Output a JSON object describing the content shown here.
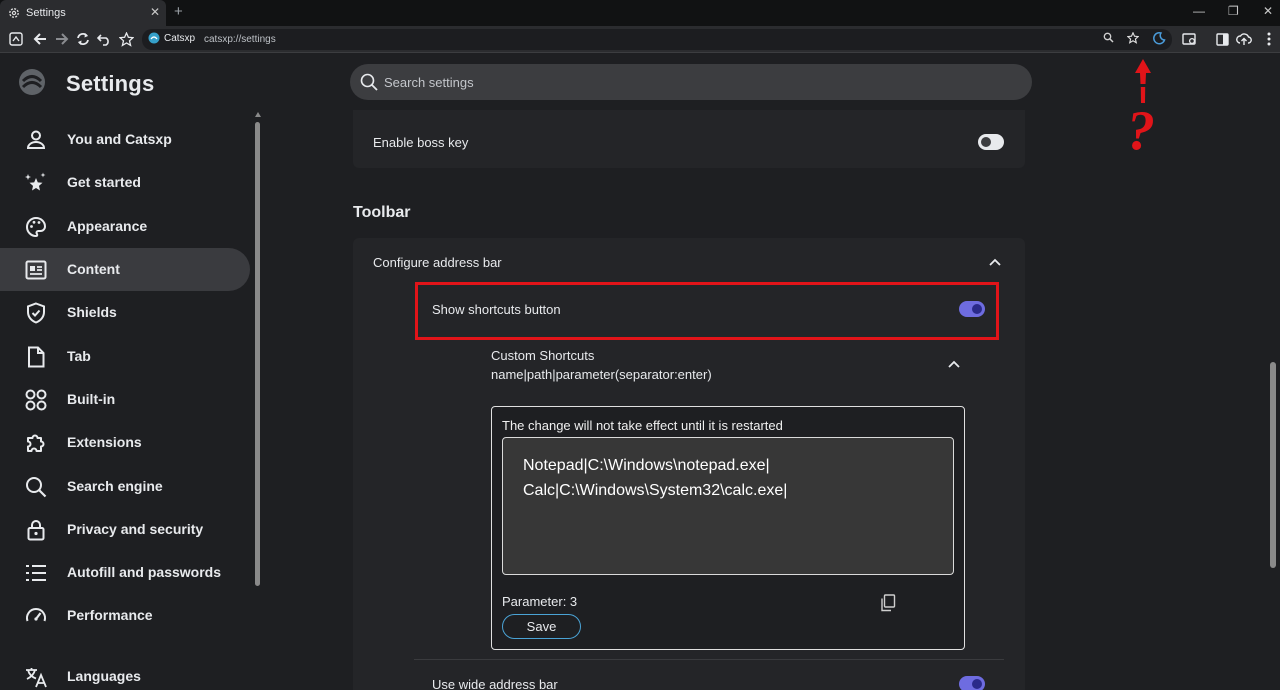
{
  "browser": {
    "tab_title": "Settings",
    "tab_close_glyph": "✕",
    "new_tab_glyph": "+",
    "window_controls": {
      "minimize": "—",
      "restore": "❐",
      "close": "✕"
    },
    "site_name": "Catsxp",
    "url": "catsxp://settings"
  },
  "header": {
    "title": "Settings",
    "search_placeholder": "Search settings"
  },
  "sidebar": {
    "items": [
      {
        "label": "You and Catsxp",
        "icon": "person-icon",
        "active": false
      },
      {
        "label": "Get started",
        "icon": "sparkle-star-icon",
        "active": false
      },
      {
        "label": "Appearance",
        "icon": "palette-icon",
        "active": false
      },
      {
        "label": "Content",
        "icon": "content-layout-icon",
        "active": true
      },
      {
        "label": "Shields",
        "icon": "shield-icon",
        "active": false
      },
      {
        "label": "Tab",
        "icon": "tab-page-icon",
        "active": false
      },
      {
        "label": "Built-in",
        "icon": "grid-circles-icon",
        "active": false
      },
      {
        "label": "Extensions",
        "icon": "puzzle-icon",
        "active": false
      },
      {
        "label": "Search engine",
        "icon": "search-icon",
        "active": false
      },
      {
        "label": "Privacy and security",
        "icon": "lock-icon",
        "active": false
      },
      {
        "label": "Autofill and passwords",
        "icon": "list-icon",
        "active": false
      },
      {
        "label": "Performance",
        "icon": "gauge-icon",
        "active": false
      },
      {
        "label": "Languages",
        "icon": "translate-icon",
        "active": false
      }
    ]
  },
  "main": {
    "boss_key": {
      "label": "Enable boss key",
      "enabled": false
    },
    "section_title": "Toolbar",
    "configure_address_bar": {
      "label": "Configure address bar",
      "expanded": true
    },
    "show_shortcuts": {
      "label": "Show shortcuts button",
      "enabled": true
    },
    "custom_shortcuts": {
      "title": "Custom Shortcuts",
      "description": "name|path|parameter(separator:enter)",
      "notice": "The change will not take effect until it is restarted",
      "value": "Notepad|C:\\Windows\\notepad.exe|\nCalc|C:\\Windows\\System32\\calc.exe|",
      "parameter_label": "Parameter: 3",
      "save_label": "Save"
    },
    "wide_address_bar": {
      "label": "Use wide address bar",
      "enabled": true
    }
  },
  "annotation": {
    "question_mark": "?"
  },
  "colors": {
    "accent_toggle": "#6e6ce0",
    "highlight": "#e11419",
    "save_border": "#4aa3d6"
  }
}
